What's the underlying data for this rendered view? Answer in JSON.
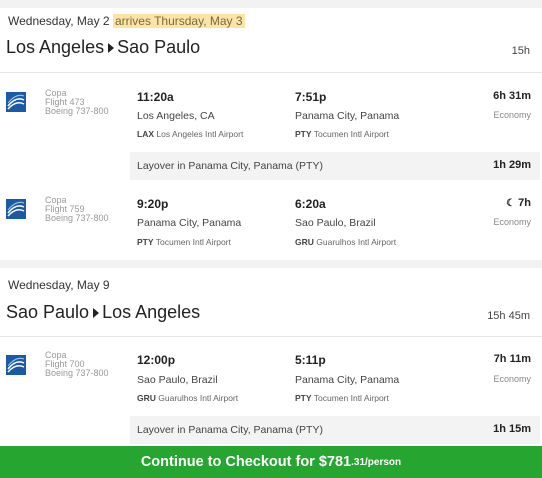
{
  "outbound": {
    "date": "Wednesday, May 2",
    "arrives_note": "arrives Thursday, May 3",
    "origin": "Los Angeles",
    "destination": "Sao Paulo",
    "total_duration": "15h",
    "segments": [
      {
        "airline": "Copa",
        "flight": "Flight 473",
        "aircraft": "Boeing 737-800",
        "depart_time": "11:20a",
        "depart_city": "Los Angeles, CA",
        "depart_code": "LAX",
        "depart_airport": "Los Angeles Intl Airport",
        "arrive_time": "7:51p",
        "arrive_city": "Panama City, Panama",
        "arrive_code": "PTY",
        "arrive_airport": "Tocumen Intl Airport",
        "duration": "6h 31m",
        "cabin": "Economy"
      },
      {
        "airline": "Copa",
        "flight": "Flight 759",
        "aircraft": "Boeing 737-800",
        "depart_time": "9:20p",
        "depart_city": "Panama City, Panama",
        "depart_code": "PTY",
        "depart_airport": "Tocumen Intl Airport",
        "arrive_time": "6:20a",
        "arrive_city": "Sao Paulo, Brazil",
        "arrive_code": "GRU",
        "arrive_airport": "Guarulhos Intl Airport",
        "duration": "7h",
        "duration_icon": "moon-icon",
        "cabin": "Economy"
      }
    ],
    "layover": {
      "text": "Layover in Panama City, Panama (PTY)",
      "duration": "1h 29m"
    }
  },
  "return": {
    "date": "Wednesday, May 9",
    "origin": "Sao Paulo",
    "destination": "Los Angeles",
    "total_duration": "15h 45m",
    "segments": [
      {
        "airline": "Copa",
        "flight": "Flight 700",
        "aircraft": "Boeing 737-800",
        "depart_time": "12:00p",
        "depart_city": "Sao Paulo, Brazil",
        "depart_code": "GRU",
        "depart_airport": "Guarulhos Intl Airport",
        "arrive_time": "5:11p",
        "arrive_city": "Panama City, Panama",
        "arrive_code": "PTY",
        "arrive_airport": "Tocumen Intl Airport",
        "duration": "7h 11m",
        "cabin": "Economy"
      }
    ],
    "layover": {
      "text": "Layover in Panama City, Panama (PTY)",
      "duration": "1h 15m"
    }
  },
  "checkout": {
    "label": "Continue to Checkout for",
    "price": "$781",
    "price_cents": ".31",
    "per": "/person"
  },
  "colors": {
    "checkout_green": "#27a531",
    "arrives_highlight": "#fbe4a6",
    "copa_blue": "#1a5aa6"
  }
}
